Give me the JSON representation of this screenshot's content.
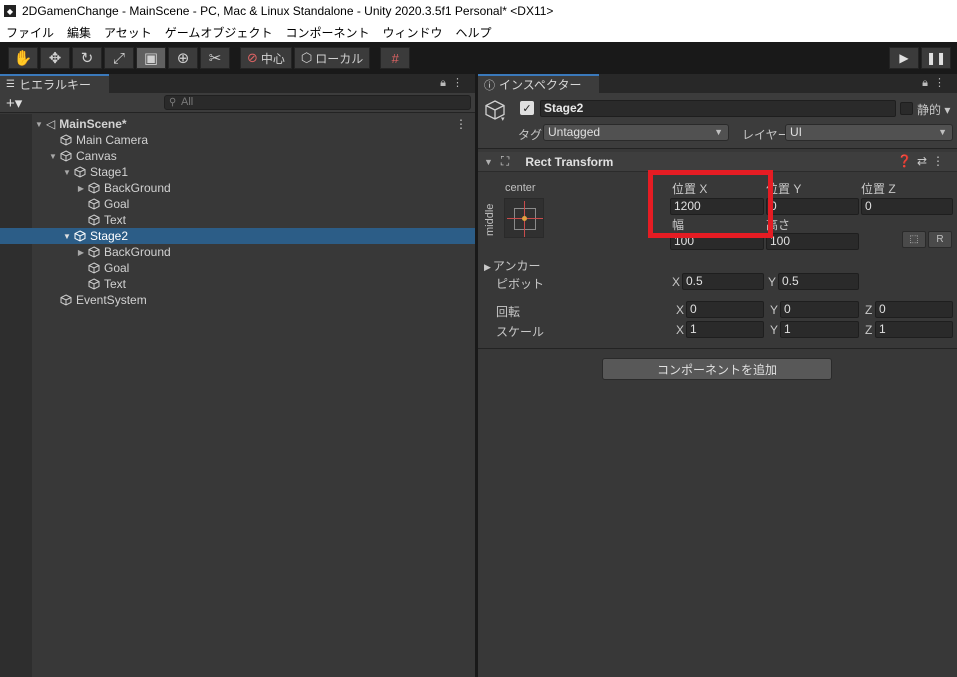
{
  "window": {
    "title": "2DGamenChange - MainScene - PC, Mac & Linux Standalone - Unity 2020.3.5f1 Personal* <DX11>"
  },
  "menu": [
    "ファイル",
    "編集",
    "アセット",
    "ゲームオブジェクト",
    "コンポーネント",
    "ウィンドウ",
    "ヘルプ"
  ],
  "toolbar": {
    "pivot": "中心",
    "space": "ローカル"
  },
  "hierarchy": {
    "tab": "ヒエラルキー",
    "search_placeholder": "All",
    "scene": "MainScene*",
    "items": [
      {
        "label": "Main Camera"
      },
      {
        "label": "Canvas"
      },
      {
        "label": "Stage1"
      },
      {
        "label": "BackGround"
      },
      {
        "label": "Goal"
      },
      {
        "label": "Text"
      },
      {
        "label": "Stage2"
      },
      {
        "label": "BackGround"
      },
      {
        "label": "Goal"
      },
      {
        "label": "Text"
      },
      {
        "label": "EventSystem"
      }
    ]
  },
  "inspector": {
    "tab": "インスペクター",
    "name": "Stage2",
    "static_label": "静的",
    "tag_label": "タグ",
    "tag_value": "Untagged",
    "layer_label": "レイヤー",
    "layer_value": "UI",
    "rect_transform": {
      "title": "Rect Transform",
      "anchor_h": "center",
      "anchor_v": "middle",
      "pos_x_label": "位置 X",
      "pos_y_label": "位置 Y",
      "pos_z_label": "位置 Z",
      "pos_x": "1200",
      "pos_y": "0",
      "pos_z": "0",
      "width_label": "幅",
      "height_label": "高さ",
      "width": "100",
      "height": "100",
      "raw_button": "R",
      "anchors_label": "アンカー",
      "pivot_label": "ピボット",
      "pivot_x": "0.5",
      "pivot_y": "0.5",
      "rotation_label": "回転",
      "rot_x": "0",
      "rot_y": "0",
      "rot_z": "0",
      "scale_label": "スケール",
      "scale_x": "1",
      "scale_y": "1",
      "scale_z": "1",
      "axis_x": "X",
      "axis_y": "Y",
      "axis_z": "Z"
    },
    "add_component": "コンポーネントを追加"
  },
  "colors": {
    "selection": "#2c5d87",
    "highlight": "#e51c23",
    "panel": "#383838"
  }
}
